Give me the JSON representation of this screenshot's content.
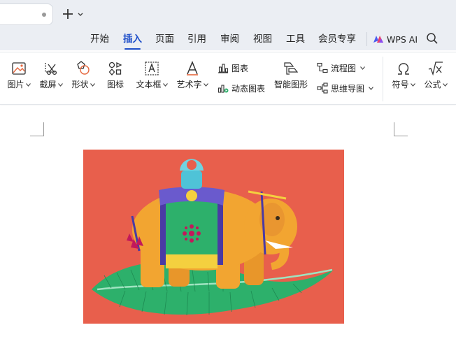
{
  "tabstrip": {
    "new_tab_label": "+"
  },
  "menu": {
    "tabs": [
      {
        "label": "开始"
      },
      {
        "label": "插入"
      },
      {
        "label": "页面"
      },
      {
        "label": "引用"
      },
      {
        "label": "审阅"
      },
      {
        "label": "视图"
      },
      {
        "label": "工具"
      },
      {
        "label": "会员专享"
      }
    ],
    "active_tab": "插入",
    "ai_label": "WPS AI"
  },
  "toolbar": {
    "picture": "图片",
    "screenshot": "截屏",
    "shape": "形状",
    "icon": "图标",
    "textbox": "文本框",
    "wordart": "艺术字",
    "chart": "图表",
    "dynamic_chart": "动态图表",
    "smart_graphic": "智能图形",
    "flowchart": "流程图",
    "mindmap": "思维导图",
    "symbol": "符号",
    "formula": "公式"
  },
  "colors": {
    "accent": "#1f4fc9",
    "tab_bar": "#ebeef3",
    "picture_background": "#e85f4c",
    "leaf_green": "#2db06b",
    "elephant_orange": "#f2a531",
    "saddle_purple": "#4a3aa4"
  },
  "document": {
    "picture_alt": "decorative elephant illustration"
  }
}
